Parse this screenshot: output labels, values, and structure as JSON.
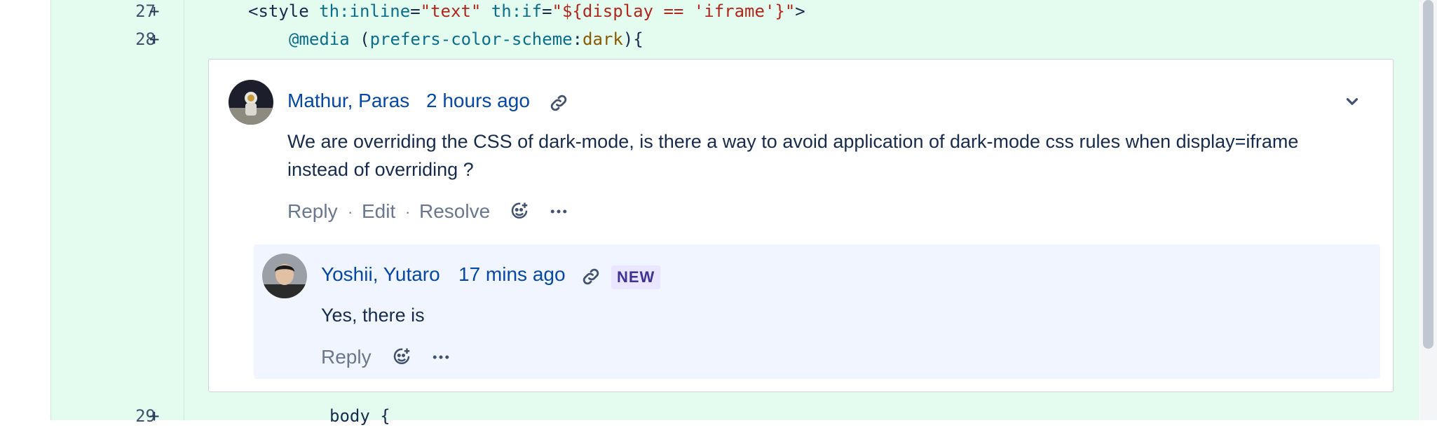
{
  "diff": {
    "lines": [
      {
        "number": "27",
        "sign": "+",
        "code": {
          "open": "<style ",
          "attr1": "th:inline",
          "eq1": "=",
          "val1": "\"text\"",
          "attr2": " th:if",
          "eq2": "=",
          "val2": "\"${display == 'iframe'}\"",
          "close": ">"
        }
      },
      {
        "number": "28",
        "sign": "+",
        "code": {
          "rule": "@media",
          "paren_open": " (",
          "prop": "prefers-color-scheme",
          "colon": ":",
          "value": "dark",
          "paren_close": "){"
        }
      },
      {
        "number": "29",
        "sign": "+",
        "code": {
          "text": "body {"
        }
      }
    ]
  },
  "comment": {
    "author": "Mathur, Paras",
    "time": "2 hours ago",
    "text_line1": "We are overriding the CSS of dark-mode, is there a way to avoid application of dark-mode css rules when display=iframe",
    "text_line2": "instead of overriding ?",
    "actions": {
      "reply": "Reply",
      "edit": "Edit",
      "resolve": "Resolve",
      "separator": "·"
    },
    "avatar_icon": "astronaut-avatar",
    "collapse_icon": "chevron-down-icon"
  },
  "reply": {
    "author": "Yoshii, Yutaro",
    "time": "17 mins ago",
    "badge": "NEW",
    "text": "Yes, there is",
    "actions": {
      "reply": "Reply"
    },
    "avatar_icon": "person-avatar"
  },
  "colors": {
    "added_bg": "#e3fcef",
    "link": "#0747a6",
    "muted": "#6b778c",
    "reply_bg": "#f0f5ff",
    "badge_bg": "#eae6ff",
    "badge_fg": "#403294"
  }
}
